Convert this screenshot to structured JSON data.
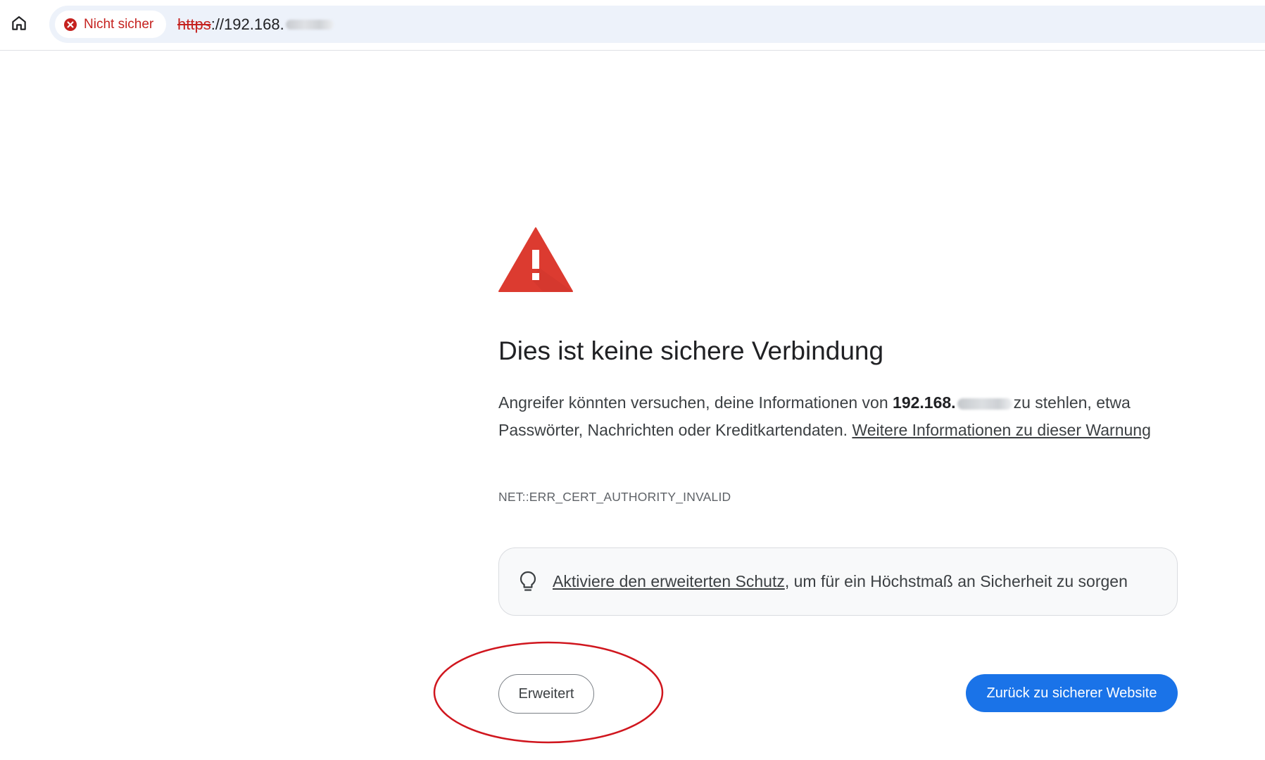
{
  "browser": {
    "security_chip_label": "Nicht sicher",
    "url_scheme": "https",
    "url_rest": "://192.168."
  },
  "interstitial": {
    "heading": "Dies ist keine sichere Verbindung",
    "body_part1": "Angreifer könnten versuchen, deine Informationen von ",
    "host_bold": "192.168.",
    "body_part2": "zu stehlen, etwa Passwörter, Nachrichten oder Kreditkartendaten. ",
    "learn_more_link": "Weitere Informationen zu dieser Warnung",
    "error_code": "NET::ERR_CERT_AUTHORITY_INVALID",
    "protection_link": "Aktiviere den erweiterten Schutz",
    "protection_text": ", um für ein Höchstmaß an Sicherheit zu sorgen",
    "advanced_button": "Erweitert",
    "back_button": "Zurück zu sicherer Website"
  },
  "colors": {
    "warning_red": "#dc3b30",
    "insecure_text": "#c5221f",
    "primary_blue": "#1a73e8",
    "annotation_red": "#d0161e"
  },
  "icons": {
    "home": "home-icon",
    "security": "error-circle-icon",
    "warning": "warning-triangle-icon",
    "protection": "lightbulb-icon"
  }
}
